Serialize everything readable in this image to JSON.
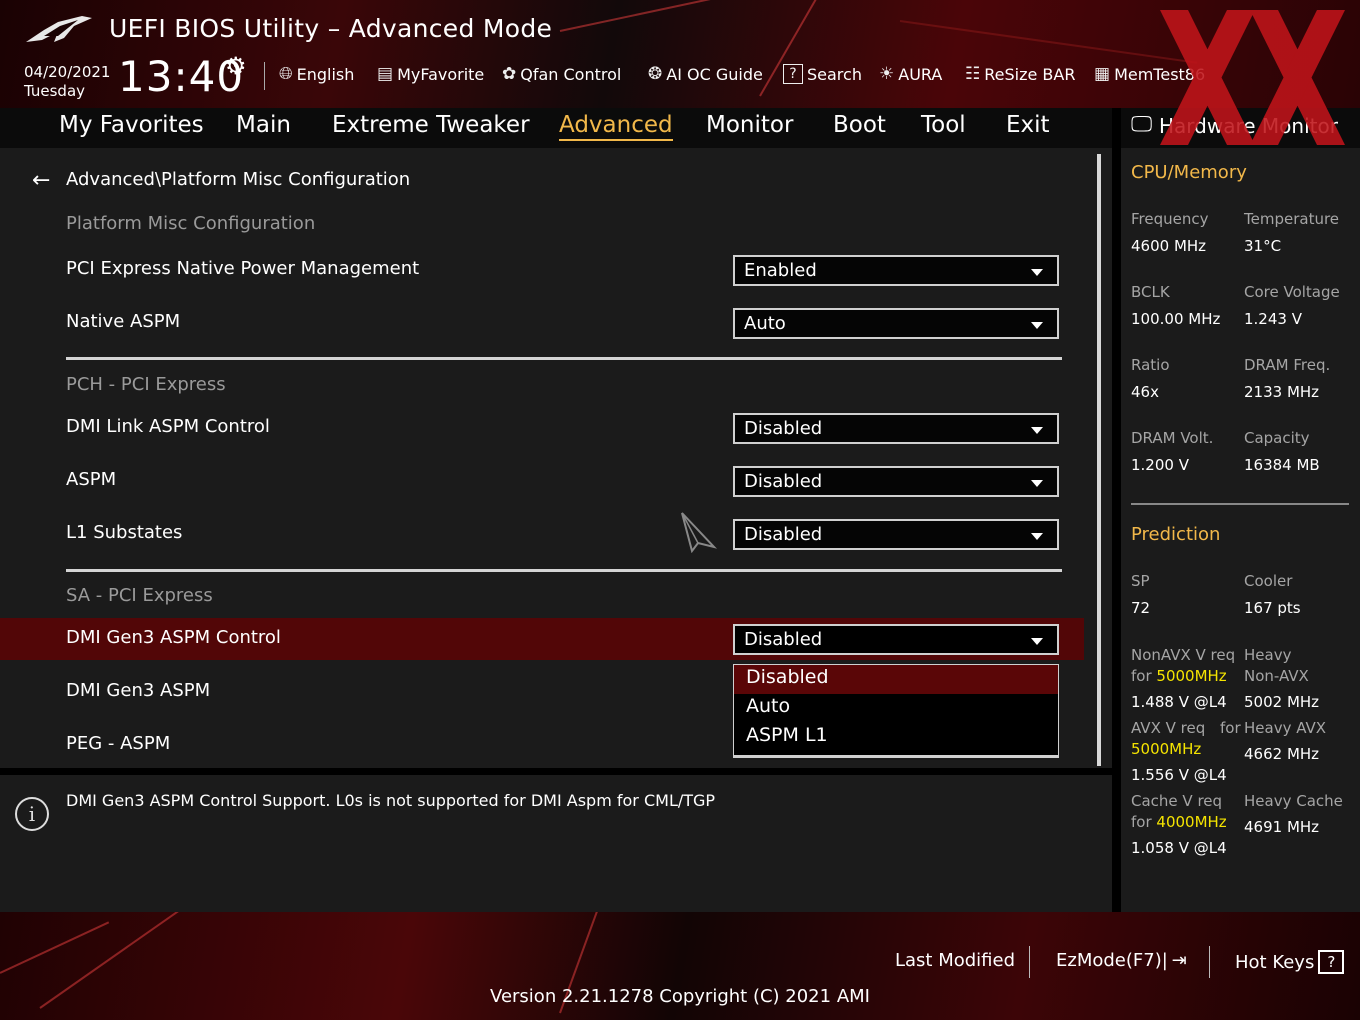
{
  "header": {
    "title": "UEFI BIOS Utility – Advanced Mode",
    "date": "04/20/2021",
    "day": "Tuesday",
    "time": "13:40",
    "toolbar": [
      {
        "label": "English",
        "icon": "globe-icon"
      },
      {
        "label": "MyFavorite",
        "icon": "favorite-icon"
      },
      {
        "label": "Qfan Control",
        "icon": "fan-icon"
      },
      {
        "label": "AI OC Guide",
        "icon": "ai-oc-icon"
      },
      {
        "label": "Search",
        "icon": "search-icon"
      },
      {
        "label": "AURA",
        "icon": "aura-icon"
      },
      {
        "label": "ReSize BAR",
        "icon": "resize-bar-icon"
      },
      {
        "label": "MemTest86",
        "icon": "memtest-icon"
      }
    ]
  },
  "nav": {
    "tabs": [
      "My Favorites",
      "Main",
      "Extreme Tweaker",
      "Advanced",
      "Monitor",
      "Boot",
      "Tool",
      "Exit"
    ],
    "active": "Advanced"
  },
  "main": {
    "breadcrumb": "Advanced\\Platform Misc Configuration",
    "sections": [
      "Platform Misc Configuration",
      "PCH - PCI Express",
      "SA - PCI Express"
    ],
    "settings": [
      {
        "label": "PCI Express Native Power Management",
        "value": "Enabled"
      },
      {
        "label": "Native ASPM",
        "value": "Auto"
      },
      {
        "label": "DMI Link ASPM Control",
        "value": "Disabled"
      },
      {
        "label": "ASPM",
        "value": "Disabled"
      },
      {
        "label": "L1 Substates",
        "value": "Disabled"
      },
      {
        "label": "DMI Gen3 ASPM Control",
        "value": "Disabled"
      },
      {
        "label": "DMI Gen3 ASPM",
        "value": ""
      },
      {
        "label": "PEG - ASPM",
        "value": ""
      }
    ],
    "dropdown_options": [
      "Disabled",
      "Auto",
      "ASPM L1"
    ],
    "dropdown_selected": "Disabled"
  },
  "help": {
    "text": "DMI Gen3 ASPM Control Support. L0s is not supported for DMI Aspm for CML/TGP"
  },
  "hwmon": {
    "title": "Hardware Monitor",
    "cpu_memory": {
      "heading": "CPU/Memory",
      "frequency_label": "Frequency",
      "frequency": "4600 MHz",
      "temperature_label": "Temperature",
      "temperature": "31°C",
      "bclk_label": "BCLK",
      "bclk": "100.00 MHz",
      "core_voltage_label": "Core Voltage",
      "core_voltage": "1.243 V",
      "ratio_label": "Ratio",
      "ratio": "46x",
      "dram_freq_label": "DRAM Freq.",
      "dram_freq": "2133 MHz",
      "dram_volt_label": "DRAM Volt.",
      "dram_volt": "1.200 V",
      "capacity_label": "Capacity",
      "capacity": "16384 MB"
    },
    "prediction": {
      "heading": "Prediction",
      "sp_label": "SP",
      "sp": "72",
      "cooler_label": "Cooler",
      "cooler": "167 pts",
      "nonavx_req_label": "NonAVX V req",
      "for_label": "for",
      "nonavx_freq": "5000MHz",
      "nonavx_v": "1.488 V @L4",
      "heavy_nonavx_label1": "Heavy",
      "heavy_nonavx_label2": "Non-AVX",
      "heavy_nonavx": "5002 MHz",
      "avx_req_label": "AVX V req",
      "avx_for_label": "for",
      "avx_freq": "5000MHz",
      "avx_v": "1.556 V @L4",
      "heavy_avx_label": "Heavy AVX",
      "heavy_avx": "4662 MHz",
      "cache_req_label": "Cache V req",
      "cache_for_label": "for",
      "cache_freq": "4000MHz",
      "cache_v": "1.058 V @L4",
      "heavy_cache_label": "Heavy Cache",
      "heavy_cache": "4691 MHz"
    }
  },
  "footer": {
    "last_modified": "Last Modified",
    "ezmode": "EzMode(F7)|",
    "hotkeys": "Hot Keys",
    "hotkeys_icon": "?",
    "version": "Version 2.21.1278 Copyright (C) 2021 AMI"
  },
  "colors": {
    "accent": "#f2b84a",
    "highlight_row": "#520607",
    "yellow_value": "#f5e400"
  }
}
